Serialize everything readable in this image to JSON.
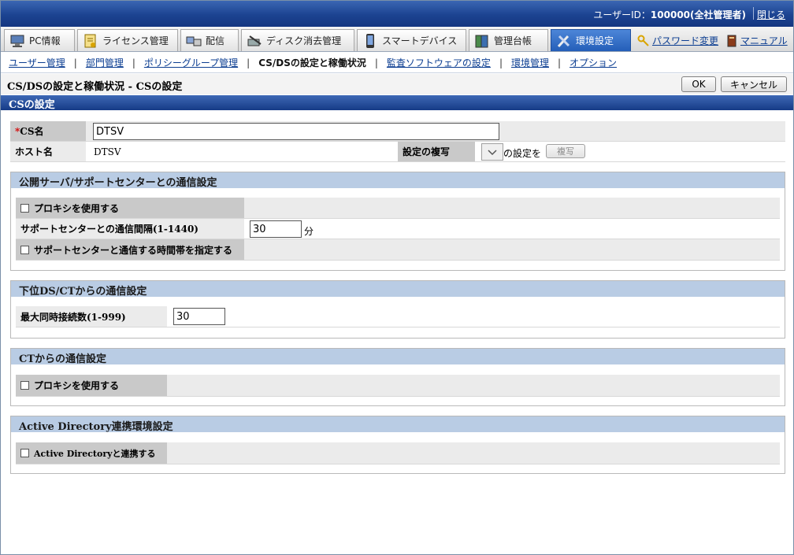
{
  "header": {
    "user_label": "ユーザーID：",
    "user_value": "100000(全社管理者)",
    "logout": "閉じる"
  },
  "tabs": [
    {
      "label": "PC情報",
      "icon": "pc-info-icon"
    },
    {
      "label": "ライセンス管理",
      "icon": "license-icon"
    },
    {
      "label": "配信",
      "icon": "distribution-icon"
    },
    {
      "label": "ディスク消去管理",
      "icon": "disk-erase-icon"
    },
    {
      "label": "スマートデバイス",
      "icon": "smart-device-icon"
    },
    {
      "label": "管理台帳",
      "icon": "ledger-icon"
    },
    {
      "label": "環境設定",
      "icon": "tools-icon"
    }
  ],
  "links": {
    "password": "パスワード変更",
    "manual": "マニュアル"
  },
  "subnav": {
    "user": "ユーザー管理",
    "dept": "部門管理",
    "policy": "ポリシーグループ管理",
    "current": "CS/DSの設定と稼働状況",
    "audit": "監査ソフトウェアの設定",
    "env": "環境管理",
    "option": "オプション"
  },
  "page": {
    "title": "CS/DSの設定と稼働状況 - CSの設定",
    "ok": "OK",
    "cancel": "キャンセル",
    "section": "CSの設定"
  },
  "cs": {
    "name_required": "*",
    "name_label": "CS名",
    "name_value": "DTSV",
    "host_label": "ホスト名",
    "host_value": "DTSV",
    "copy_label": "設定の複写",
    "copy_suffix": "の設定を",
    "copy_button": "複写"
  },
  "public_comm": {
    "title": "公開サーバ/サポートセンターとの通信設定",
    "proxy": "プロキシを使用する",
    "interval_label": "サポートセンターとの通信間隔(1-1440)",
    "interval_value": "30",
    "interval_unit": "分",
    "timeband": "サポートセンターと通信する時間帯を指定する"
  },
  "lower_comm": {
    "title": "下位DS/CTからの通信設定",
    "max_label": "最大同時接続数(1-999)",
    "max_value": "30"
  },
  "ct_comm": {
    "title": "CTからの通信設定",
    "proxy": "プロキシを使用する"
  },
  "ad": {
    "title": "Active Directory連携環境設定",
    "link": "Active Directoryと連携する"
  }
}
